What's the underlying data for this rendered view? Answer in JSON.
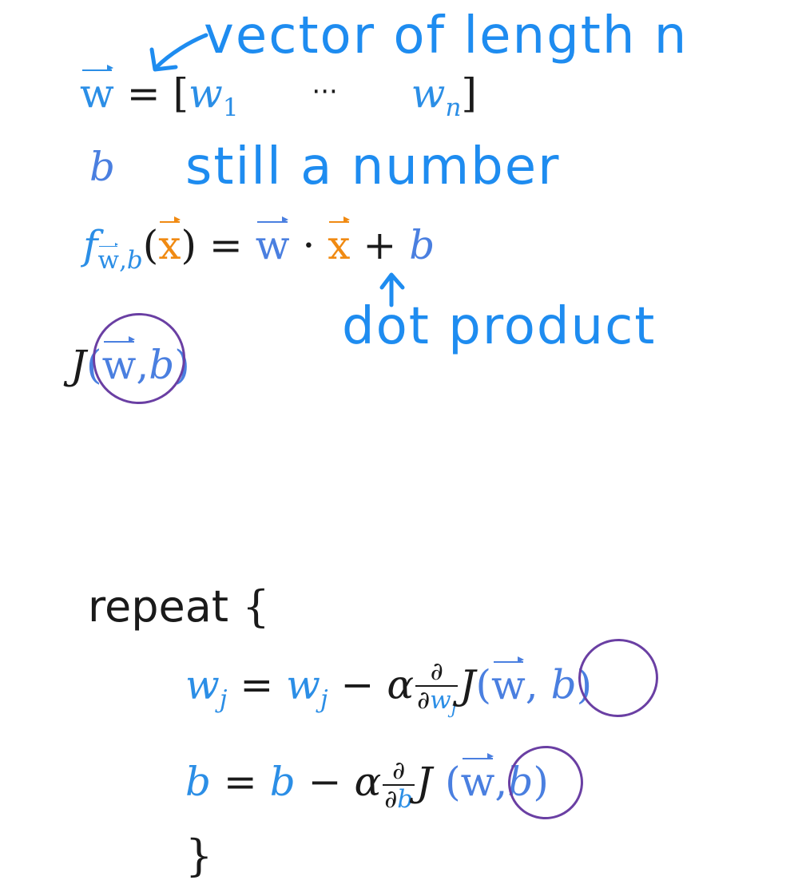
{
  "annotations": {
    "vector_note": "vector of length n",
    "b_note": "still a number",
    "dot_note": "dot product"
  },
  "eq_w": {
    "lhs": "w",
    "eq": "=",
    "open": "[",
    "w": "w",
    "sub1": "1",
    "dots": "···",
    "wn": "w",
    "subn": "n",
    "close": "]"
  },
  "eq_b": {
    "b": "b"
  },
  "eq_f": {
    "f": "f",
    "sub_w": "w",
    "sub_comma": ",",
    "sub_b": "b",
    "open": "(",
    "x": "x",
    "close": ")",
    "eq": "=",
    "w": "w",
    "dot": "·",
    "x2": "x",
    "plus": "+",
    "b": "b"
  },
  "eq_j": {
    "J": "J",
    "open": "(",
    "w": "w",
    "comma": ",",
    "b": "b",
    "close": ")"
  },
  "repeat_block": {
    "keyword": "repeat",
    "open_brace": "{",
    "close_brace": "}",
    "line1": {
      "w": "w",
      "j": "j",
      "eq": "=",
      "w2": "w",
      "j2": "j",
      "minus": "−",
      "alpha": "α",
      "partial_num": "∂",
      "partial_den": "∂",
      "den_w": "w",
      "den_j": "j",
      "J": "J",
      "open": "(",
      "vw": "w",
      "comma": ",",
      "b": "b",
      "close": ")"
    },
    "line2": {
      "b": "b",
      "eq": "=",
      "b2": "b",
      "minus": "−",
      "alpha": "α",
      "partial_num": "∂",
      "partial_den": "∂",
      "den_b": "b",
      "J": "J",
      "open": "(",
      "vw": "w",
      "comma": ",",
      "b3": "b",
      "close": ")"
    }
  },
  "colors": {
    "blue": "#2b8ee6",
    "light_blue": "#4a7fe0",
    "orange": "#f08a12",
    "purple_circle": "#6a3fa3",
    "ink": "#1a1a1a"
  }
}
